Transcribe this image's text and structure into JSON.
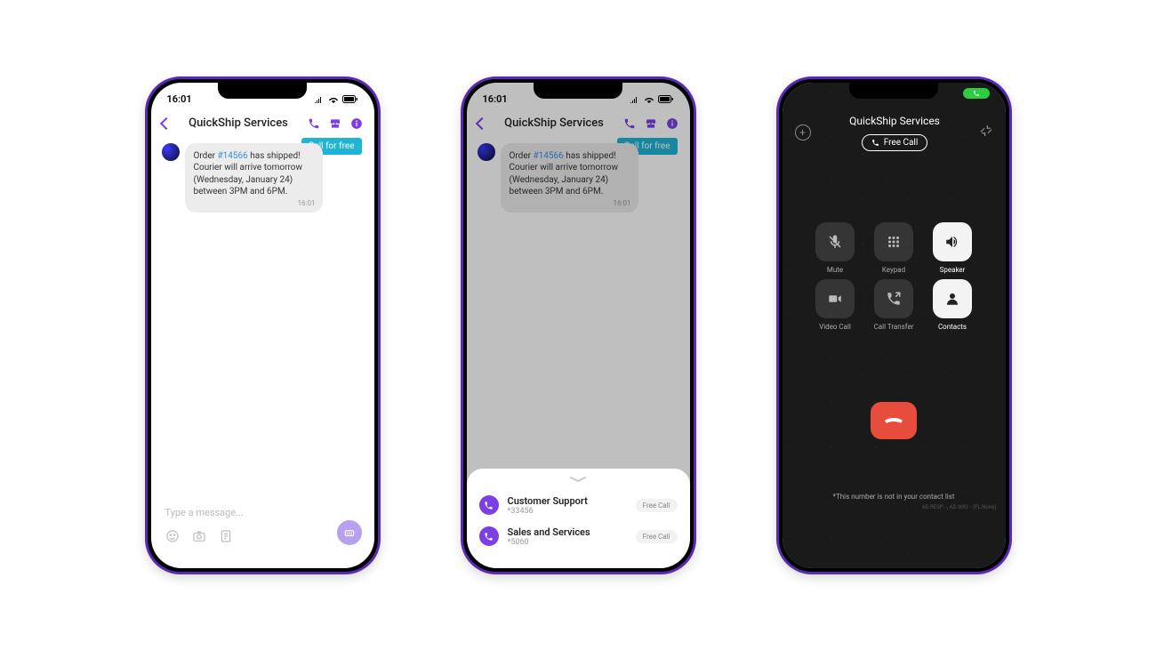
{
  "statusbar": {
    "time": "16:01"
  },
  "chat": {
    "title": "QuickShip Services",
    "call_badge": "Call for free",
    "message": {
      "prefix": "Order ",
      "order": "#14566",
      "body": " has shipped! Courier will arrive tomorrow (Wednesday, January 24) between 3PM and 6PM.",
      "time": "16:01"
    },
    "input_placeholder": "Type a message..."
  },
  "sheet": {
    "contacts": [
      {
        "name": "Customer Support",
        "number": "*33456",
        "pill": "Free Call"
      },
      {
        "name": "Sales and Services",
        "number": "*5060",
        "pill": "Free Call"
      }
    ]
  },
  "call": {
    "title": "QuickShip Services",
    "chip": "Free Call",
    "buttons": {
      "mute": "Mute",
      "keypad": "Keypad",
      "speaker": "Speaker",
      "video": "Video Call",
      "transfer": "Call Transfer",
      "contacts": "Contacts"
    },
    "note": "*This number is not in your contact list",
    "debug": "AD RESP: -, AD IMG: - (FL:None)"
  }
}
